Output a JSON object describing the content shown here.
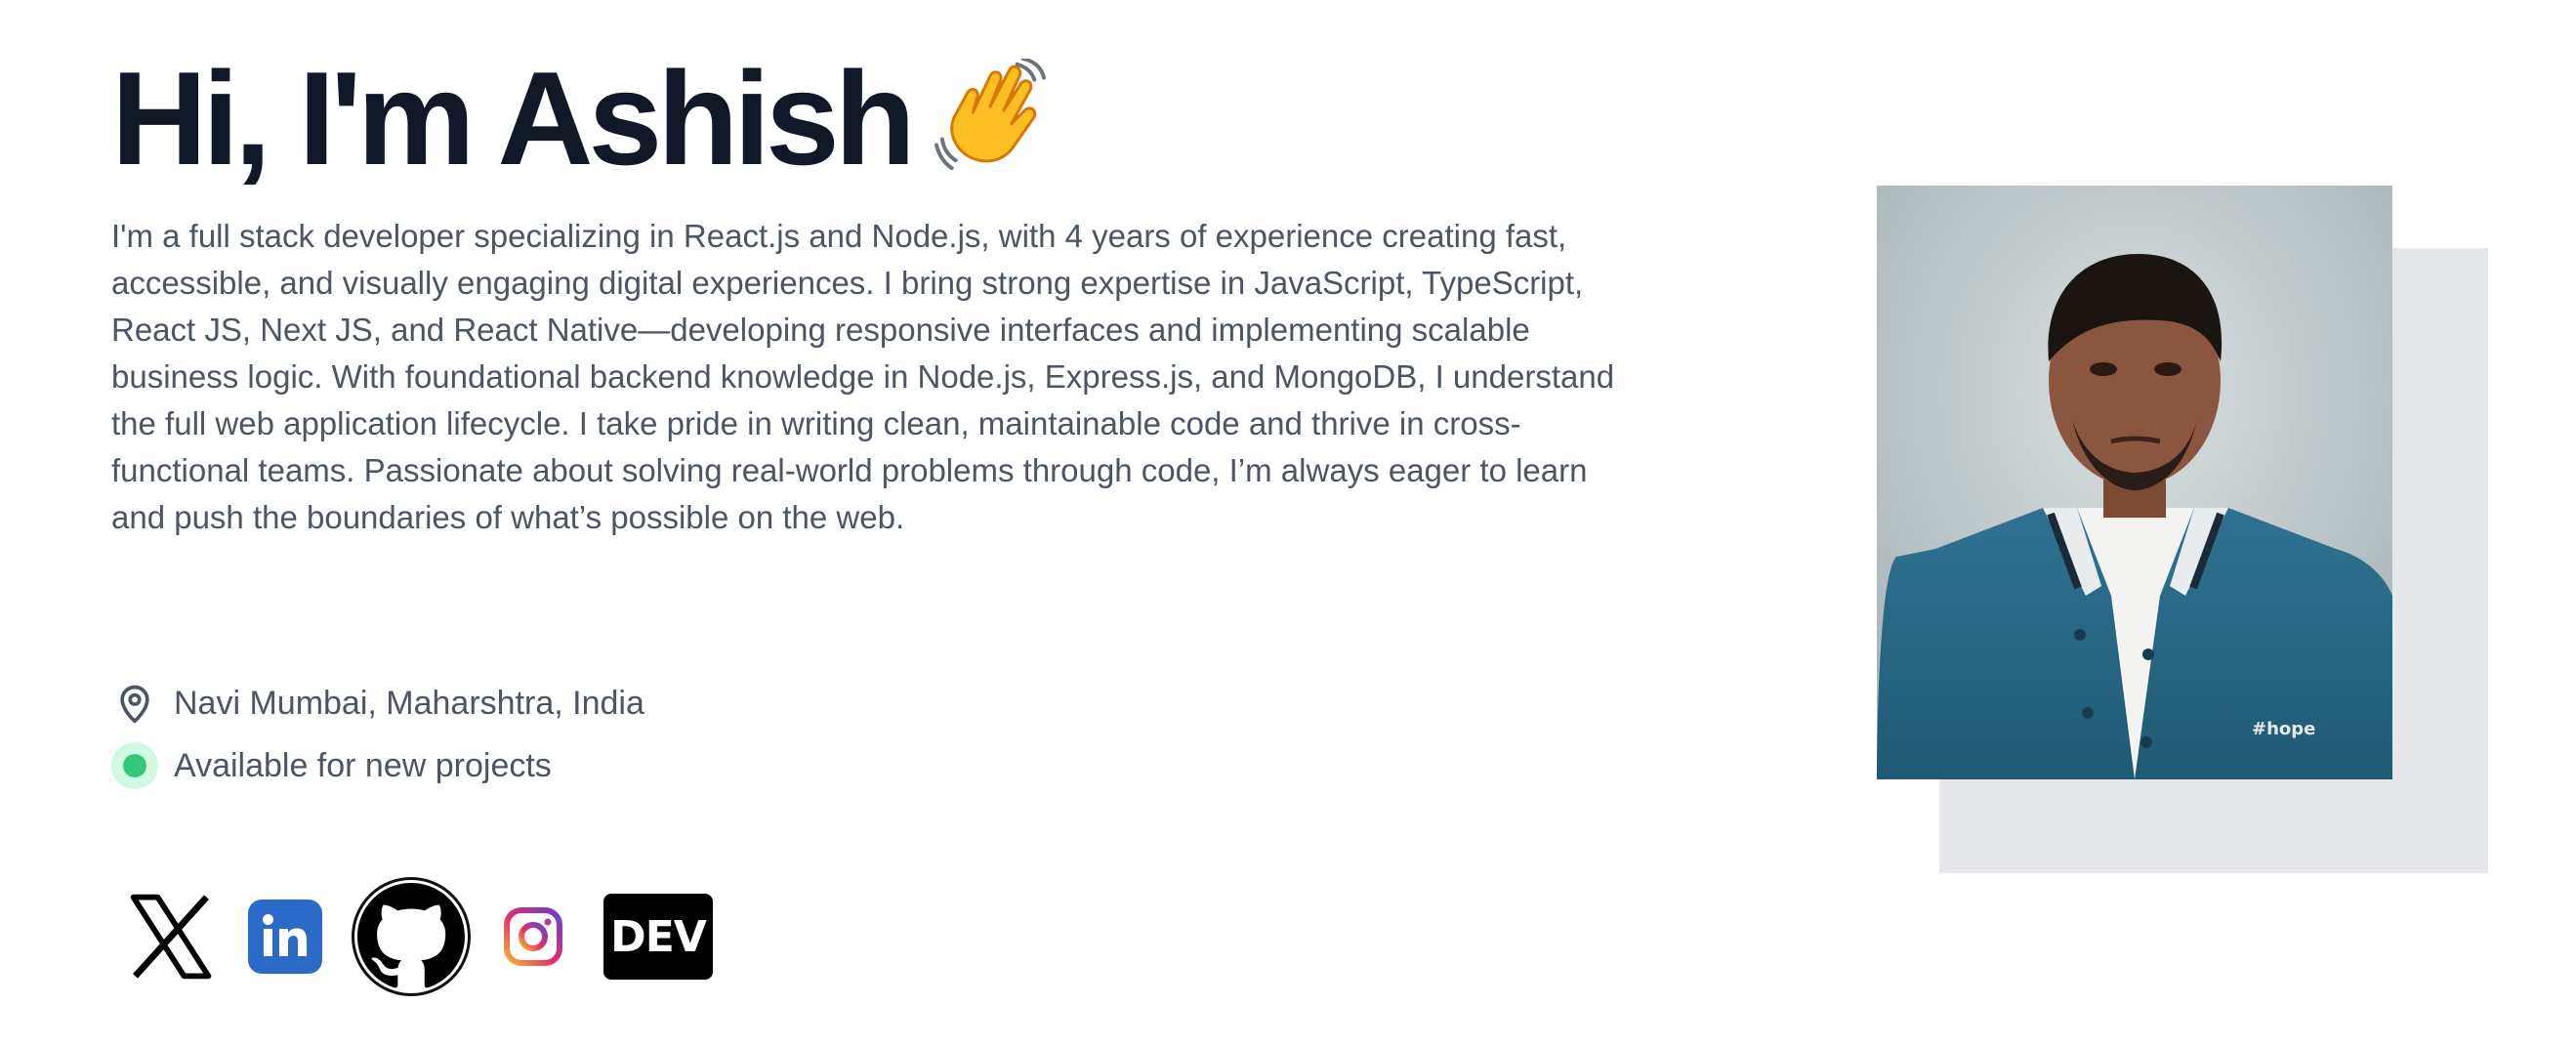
{
  "hero": {
    "title": "Hi, I'm Ashish",
    "wave_emoji": "👋",
    "bio": "I'm a full stack developer specializing in React.js and Node.js, with 4 years of experience creating fast, accessible, and visually engaging digital experiences. I bring strong expertise in JavaScript, TypeScript, React JS, Next JS, and React Native—developing responsive interfaces and implementing scalable business logic. With foundational backend knowledge in Node.js, Express.js, and MongoDB, I understand the full web application lifecycle. I take pride in writing clean, maintainable code and thrive in cross-functional teams. Passionate about solving real-world problems through code, I’m always eager to learn and push the boundaries of what’s possible on the web."
  },
  "meta": {
    "location": "Navi Mumbai, Maharshtra, India",
    "location_icon": "map-pin-icon",
    "availability": "Available for new projects",
    "availability_color": "#34c77b"
  },
  "socials": [
    {
      "name": "x-icon"
    },
    {
      "name": "linkedin-icon",
      "label": "in",
      "color": "#2b6ac6"
    },
    {
      "name": "github-icon"
    },
    {
      "name": "instagram-icon"
    },
    {
      "name": "dev-icon",
      "label": "DEV"
    }
  ],
  "photo": {
    "shirt_text": "#hope"
  },
  "colors": {
    "title": "#111827",
    "body_text": "#4b5563",
    "photo_backdrop": "#e5e7eb"
  }
}
